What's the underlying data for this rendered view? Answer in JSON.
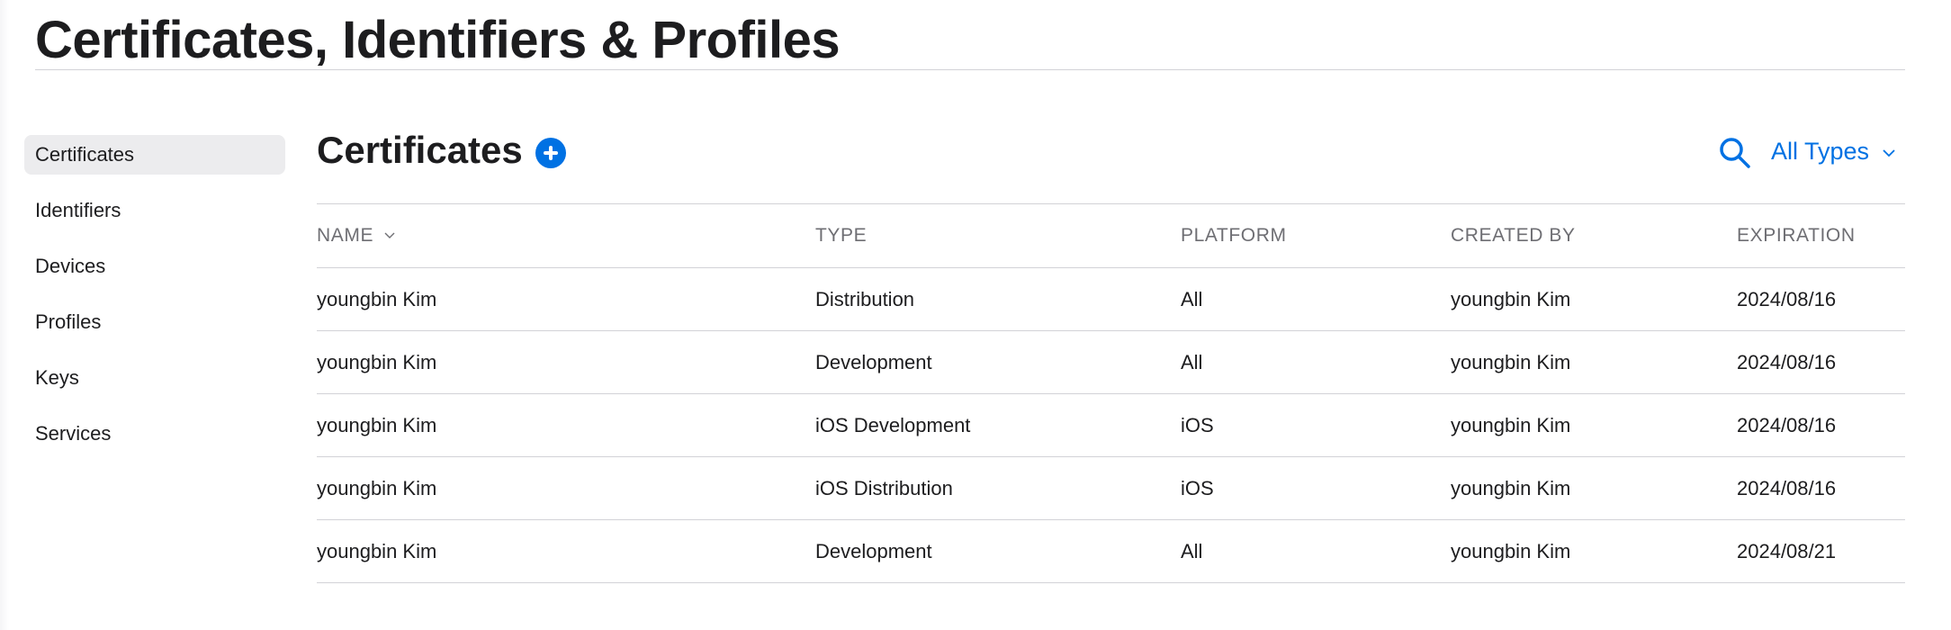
{
  "header": {
    "title": "Certificates, Identifiers & Profiles"
  },
  "sidebar": {
    "items": [
      {
        "label": "Certificates",
        "active": true
      },
      {
        "label": "Identifiers"
      },
      {
        "label": "Devices"
      },
      {
        "label": "Profiles"
      },
      {
        "label": "Keys"
      },
      {
        "label": "Services"
      }
    ]
  },
  "main": {
    "title": "Certificates",
    "add_icon": "plus-circle-icon",
    "search_icon": "search-icon",
    "filter": {
      "label": "All Types",
      "icon": "chevron-down-icon"
    },
    "accent_color": "#0071e3",
    "table": {
      "columns": [
        "NAME",
        "TYPE",
        "PLATFORM",
        "CREATED BY",
        "EXPIRATION"
      ],
      "sorted_by": "NAME",
      "rows": [
        [
          "youngbin Kim",
          "Distribution",
          "All",
          "youngbin Kim",
          "2024/08/16"
        ],
        [
          "youngbin Kim",
          "Development",
          "All",
          "youngbin Kim",
          "2024/08/16"
        ],
        [
          "youngbin Kim",
          "iOS Development",
          "iOS",
          "youngbin Kim",
          "2024/08/16"
        ],
        [
          "youngbin Kim",
          "iOS Distribution",
          "iOS",
          "youngbin Kim",
          "2024/08/16"
        ],
        [
          "youngbin Kim",
          "Development",
          "All",
          "youngbin Kim",
          "2024/08/21"
        ]
      ]
    }
  }
}
